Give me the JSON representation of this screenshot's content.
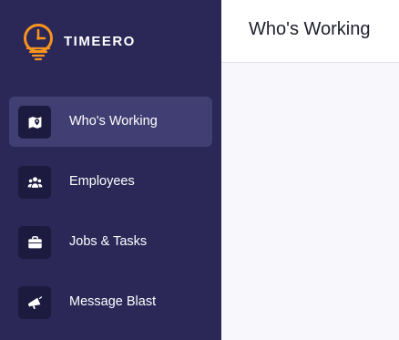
{
  "brand": {
    "name": "TIMEERO",
    "accent_color": "#f7941d",
    "icon": "clock-pin-logo-icon"
  },
  "sidebar": {
    "background": "#2b2858",
    "items": [
      {
        "label": "Who's Working",
        "icon": "map-pin-icon",
        "active": true
      },
      {
        "label": "Employees",
        "icon": "users-icon",
        "active": false
      },
      {
        "label": "Jobs & Tasks",
        "icon": "briefcase-icon",
        "active": false
      },
      {
        "label": "Message Blast",
        "icon": "megaphone-icon",
        "active": false
      }
    ]
  },
  "header": {
    "title": "Who's Working"
  }
}
